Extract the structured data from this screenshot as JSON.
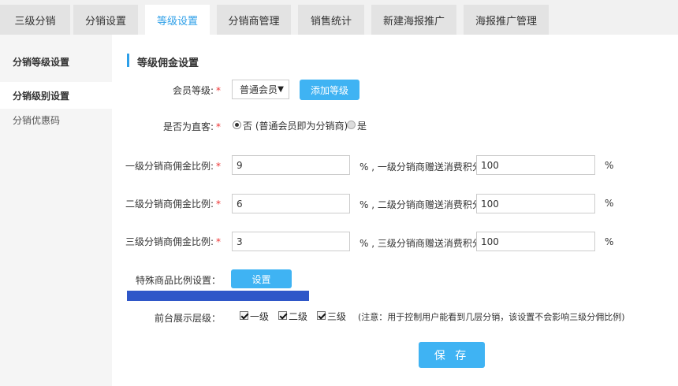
{
  "tabs": [
    {
      "label": "三级分销"
    },
    {
      "label": "分销设置"
    },
    {
      "label": "等级设置"
    },
    {
      "label": "分销商管理"
    },
    {
      "label": "销售统计"
    },
    {
      "label": "新建海报推广"
    },
    {
      "label": "海报推广管理"
    }
  ],
  "active_tab": "等级设置",
  "sidebar": {
    "items": [
      {
        "label": "分销等级设置"
      },
      {
        "label": "分销级别设置"
      },
      {
        "label": "分销优惠码"
      }
    ]
  },
  "section": {
    "title": "等级佣金设置"
  },
  "form": {
    "member_level": {
      "label": "会员等级:",
      "required": "*",
      "selected": "普通会员",
      "add_button": "添加等级"
    },
    "direct_customer": {
      "label": "是否为直客:",
      "required": "*",
      "option_no": "否 (普通会员即为分销商)",
      "option_yes": "是",
      "selected": "否"
    },
    "levels": [
      {
        "label": "一级分销商佣金比例:",
        "required": "*",
        "value": "9",
        "suffix": "% , 一级分销商赠送消费积分:",
        "points": "100",
        "unit": "%"
      },
      {
        "label": "二级分销商佣金比例:",
        "required": "*",
        "value": "6",
        "suffix": "% , 二级分销商赠送消费积分:",
        "points": "100",
        "unit": "%"
      },
      {
        "label": "三级分销商佣金比例:",
        "required": "*",
        "value": "3",
        "suffix": "% , 三级分销商赠送消费积分:",
        "points": "100",
        "unit": "%"
      }
    ],
    "special": {
      "label": "特殊商品比例设置：",
      "button": "设置"
    },
    "display_levels": {
      "label": "前台展示层级：",
      "options": [
        {
          "label": "一级",
          "checked": true
        },
        {
          "label": "二级",
          "checked": true
        },
        {
          "label": "三级",
          "checked": true
        }
      ],
      "note": "(注意：用于控制用户能看到几层分销，该设置不会影响三级分佣比例)"
    },
    "save_button": "保 存"
  },
  "colors": {
    "accent": "#3fb3f3",
    "active_tab_text": "#2d9fe8",
    "required": "#e33333",
    "strip": "#2f57c8"
  }
}
